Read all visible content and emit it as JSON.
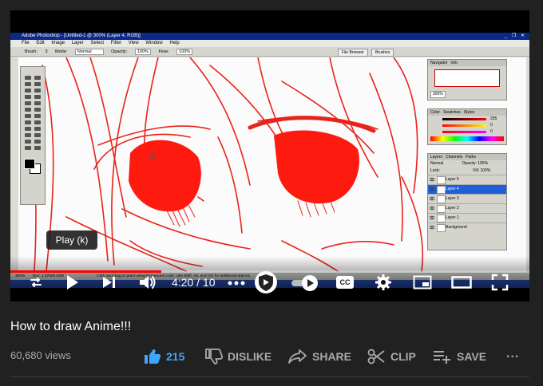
{
  "photoshop": {
    "window_title": "Adobe Photoshop - [Untitled-1 @ 300% (Layer 4, RGB)]",
    "window_buttons": "_ ❐ ✕",
    "menu": [
      "File",
      "Edit",
      "Image",
      "Layer",
      "Select",
      "Filter",
      "View",
      "Window",
      "Help"
    ],
    "options": {
      "brush_label": "Brush:",
      "brush_size": "3",
      "mode_label": "Mode:",
      "mode_value": "Normal",
      "opacity_label": "Opacity:",
      "opacity_value": "100%",
      "flow_label": "Flow:",
      "flow_value": "100%"
    },
    "tabs": {
      "file_browser": "File Browser",
      "brushes": "Brushes"
    },
    "navigator": {
      "tabs": [
        "Navigator",
        "Info"
      ],
      "zoom": "300%"
    },
    "color_panel": {
      "tabs": [
        "Color",
        "Swatches",
        "Styles"
      ],
      "r": "255",
      "g": "0",
      "b": "0"
    },
    "layers_panel": {
      "tabs": [
        "Layers",
        "Channels",
        "Paths"
      ],
      "blend_mode": "Normal",
      "opacity_label": "Opacity:",
      "opacity_value": "100%",
      "lock_label": "Lock:",
      "fill_label": "Fill:",
      "fill_value": "100%",
      "layers": [
        {
          "name": "Layer 5",
          "selected": false
        },
        {
          "name": "Layer 4",
          "selected": true
        },
        {
          "name": "Layer 3",
          "selected": false
        },
        {
          "name": "Layer 2",
          "selected": false
        },
        {
          "name": "Layer 1",
          "selected": false
        },
        {
          "name": "Background",
          "selected": false
        }
      ]
    },
    "status": {
      "zoom": "300%",
      "doc": "Doc: 1.37M/6.03M",
      "hint": "Click and drag to paint using foreground color. Use Shift, Alt, and Ctrl for additional options."
    }
  },
  "player": {
    "tooltip": "Play (k)",
    "time": "4:20 / 10",
    "progress_fraction": 0.29,
    "icons": [
      "loop-icon",
      "play-icon",
      "next-icon",
      "volume-icon",
      "more-icon",
      "sponsor-shield-icon",
      "autoplay-toggle-icon",
      "captions-icon",
      "settings-icon",
      "miniplayer-icon",
      "theater-icon",
      "fullscreen-icon"
    ],
    "cc_label": "CC"
  },
  "video": {
    "title": "How to draw Anime!!!",
    "views": "60,680 views",
    "like_count": "215",
    "dislike_label": "DISLIKE",
    "share_label": "SHARE",
    "clip_label": "CLIP",
    "save_label": "SAVE",
    "more_label": "...",
    "accent_color": "#3ea6ff"
  }
}
